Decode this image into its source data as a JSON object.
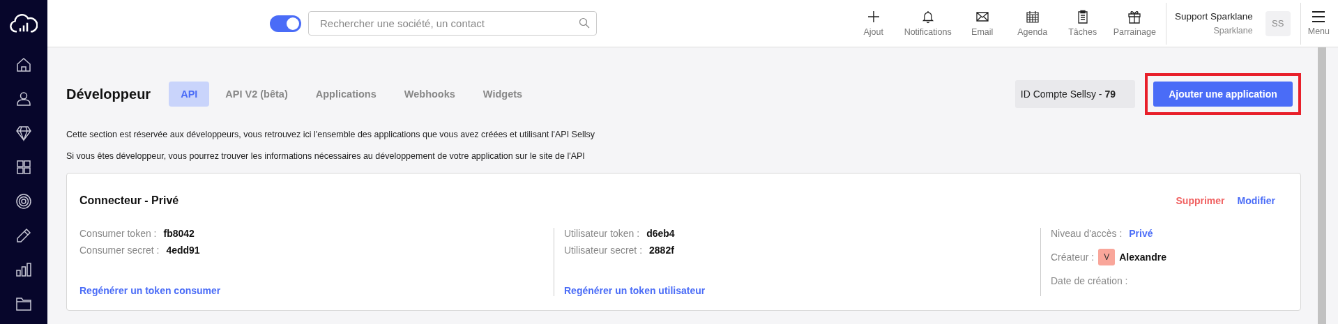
{
  "topbar": {
    "toggle": {
      "on": true
    },
    "search": {
      "placeholder": "Rechercher une société, un contact"
    },
    "actions": [
      {
        "kind": "plus",
        "label": "Ajout"
      },
      {
        "kind": "bell",
        "label": "Notifications"
      },
      {
        "kind": "mail",
        "label": "Email"
      },
      {
        "kind": "calendar",
        "label": "Agenda"
      },
      {
        "kind": "clipboard",
        "label": "Tâches"
      },
      {
        "kind": "gift",
        "label": "Parrainage"
      }
    ],
    "user": {
      "name": "Support Sparklane",
      "company": "Sparklane",
      "initials": "SS"
    },
    "menu": {
      "label": "Menu"
    }
  },
  "sidebar": {
    "items": [
      {
        "kind": "home"
      },
      {
        "kind": "user"
      },
      {
        "kind": "diamond"
      },
      {
        "kind": "grid"
      },
      {
        "kind": "target"
      },
      {
        "kind": "pencil"
      },
      {
        "kind": "chart"
      },
      {
        "kind": "folder"
      }
    ]
  },
  "page": {
    "title": "Développeur",
    "tabs": [
      {
        "label": "API",
        "selected": true
      },
      {
        "label": "API V2 (bêta)",
        "selected": false
      },
      {
        "label": "Applications",
        "selected": false
      },
      {
        "label": "Webhooks",
        "selected": false
      },
      {
        "label": "Widgets",
        "selected": false
      }
    ],
    "account_id": {
      "label": "ID Compte Sellsy - ",
      "value": "79"
    },
    "add_button": {
      "label": "Ajouter une application",
      "highlighted": true
    },
    "intro": [
      "Cette section est réservée aux développeurs, vous retrouvez ici l'ensemble des applications que vous avez créées et utilisant l'API Sellsy",
      "Si vous êtes développeur, vous pourrez trouver les informations nécessaires au développement de votre application sur le site de l'API"
    ]
  },
  "card": {
    "title": "Connecteur - Privé",
    "delete": "Supprimer",
    "edit": "Modifier",
    "consumer": {
      "fields": [
        {
          "label": "Consumer token :",
          "value": "fb8042"
        },
        {
          "label": "Consumer secret :",
          "value": "4edd91"
        }
      ],
      "link": "Regénérer un token consumer"
    },
    "user": {
      "fields": [
        {
          "label": "Utilisateur token :",
          "value": "d6eb4"
        },
        {
          "label": "Utilisateur secret :",
          "value": "2882f"
        }
      ],
      "link": "Regénérer un token utilisateur"
    },
    "access": {
      "label": "Niveau d'accès :",
      "value": "Privé"
    },
    "creator": {
      "label": "Créateur :",
      "initial": "V",
      "name": "Alexandre"
    },
    "created": {
      "label": "Date de création :"
    }
  }
}
